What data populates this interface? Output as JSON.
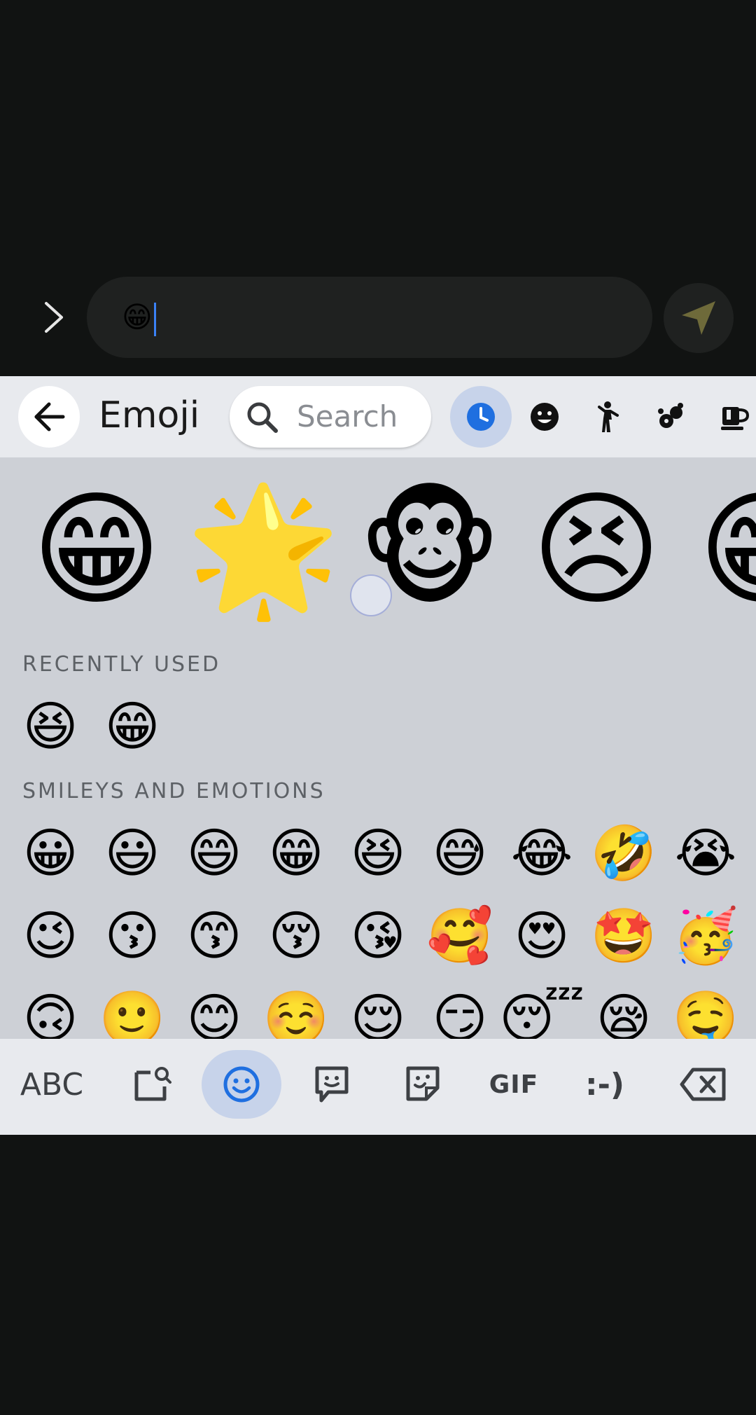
{
  "message_input": {
    "value": "😁"
  },
  "keyboard": {
    "header": {
      "title": "Emoji",
      "search_placeholder": "Search",
      "categories": [
        {
          "icon": "clock-icon",
          "active": true
        },
        {
          "icon": "smiley-icon",
          "active": false
        },
        {
          "icon": "person-icon",
          "active": false
        },
        {
          "icon": "animal-icon",
          "active": false
        },
        {
          "icon": "food-icon",
          "active": false
        }
      ]
    },
    "suggestions": [
      "😁",
      "🌟",
      "🐵",
      "😣",
      "😁"
    ],
    "sections": {
      "recent_label": "RECENTLY USED",
      "recent": [
        "😆",
        "😁"
      ],
      "smileys_label": "SMILEYS AND EMOTIONS",
      "smileys_rows": [
        [
          "😀",
          "😃",
          "😄",
          "😁",
          "😆",
          "😅",
          "😂",
          "🤣",
          "😭"
        ],
        [
          "😉",
          "😗",
          "😙",
          "😚",
          "😘",
          "🥰",
          "😍",
          "🤩",
          "🥳"
        ],
        [
          "🙃",
          "🙂",
          "😊",
          "☺️",
          "😌",
          "😏",
          "😴",
          "😪",
          "🤤"
        ]
      ]
    },
    "bottom_bar": {
      "abc_label": "ABC",
      "gif_label": "GIF",
      "emoticon_label": ":-)"
    }
  }
}
